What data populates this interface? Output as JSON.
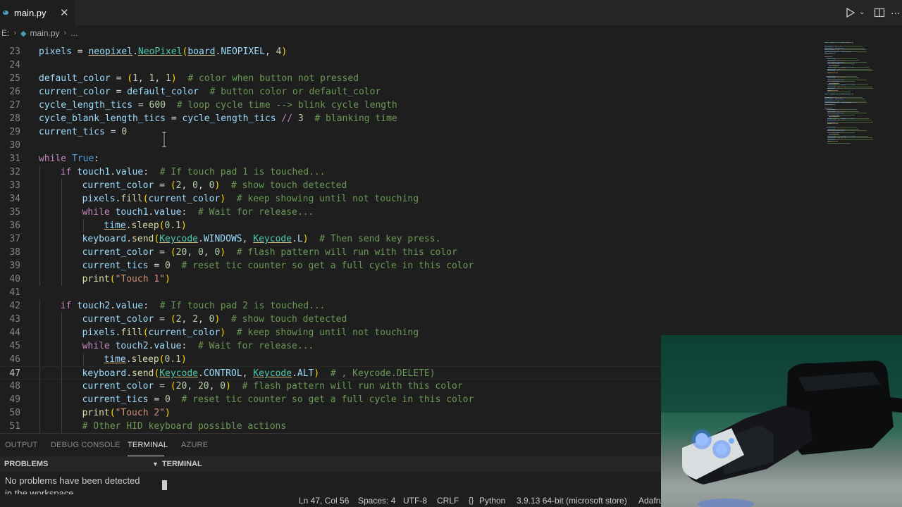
{
  "tab": {
    "filename": "main.py",
    "close": "✕"
  },
  "toolbar": {
    "run": "Run Python File",
    "split": "Split Editor",
    "more": "..."
  },
  "breadcrumb": {
    "drive": "E:",
    "file": "main.py",
    "more": "..."
  },
  "editor": {
    "current_line": 47,
    "lines": [
      {
        "n": "23",
        "indent": 0,
        "tokens": [
          [
            "var",
            "pixels"
          ],
          [
            "op",
            " = "
          ],
          [
            "var u",
            "neopixel"
          ],
          [
            "op",
            "."
          ],
          [
            "cls u",
            "NeoPixel"
          ],
          [
            "br1",
            "("
          ],
          [
            "var u",
            "board"
          ],
          [
            "op",
            "."
          ],
          [
            "var",
            "NEOPIXEL"
          ],
          [
            "op",
            ", "
          ],
          [
            "num",
            "4"
          ],
          [
            "br1",
            ")"
          ]
        ]
      },
      {
        "n": "24",
        "indent": 0,
        "tokens": []
      },
      {
        "n": "25",
        "indent": 0,
        "tokens": [
          [
            "var",
            "default_color"
          ],
          [
            "op",
            " = "
          ],
          [
            "br1",
            "("
          ],
          [
            "num",
            "1"
          ],
          [
            "op",
            ", "
          ],
          [
            "num",
            "1"
          ],
          [
            "op",
            ", "
          ],
          [
            "num",
            "1"
          ],
          [
            "br1",
            ")"
          ],
          [
            "op",
            "  "
          ],
          [
            "cm",
            "# color when button not pressed"
          ]
        ]
      },
      {
        "n": "26",
        "indent": 0,
        "tokens": [
          [
            "var",
            "current_color"
          ],
          [
            "op",
            " = "
          ],
          [
            "var",
            "default_color"
          ],
          [
            "op",
            "  "
          ],
          [
            "cm",
            "# button color or default_color"
          ]
        ]
      },
      {
        "n": "27",
        "indent": 0,
        "tokens": [
          [
            "var",
            "cycle_length_tics"
          ],
          [
            "op",
            " = "
          ],
          [
            "num",
            "600"
          ],
          [
            "op",
            "  "
          ],
          [
            "cm",
            "# loop cycle time --> blink cycle length"
          ]
        ]
      },
      {
        "n": "28",
        "indent": 0,
        "tokens": [
          [
            "var",
            "cycle_blank_length_tics"
          ],
          [
            "op",
            " = "
          ],
          [
            "var",
            "cycle_length_tics"
          ],
          [
            "op",
            " "
          ],
          [
            "kw",
            "//"
          ],
          [
            "op",
            " "
          ],
          [
            "num",
            "3"
          ],
          [
            "op",
            "  "
          ],
          [
            "cm",
            "# blanking time"
          ]
        ]
      },
      {
        "n": "29",
        "indent": 0,
        "tokens": [
          [
            "var",
            "current_tics"
          ],
          [
            "op",
            " = "
          ],
          [
            "num",
            "0"
          ]
        ]
      },
      {
        "n": "30",
        "indent": 0,
        "tokens": []
      },
      {
        "n": "31",
        "indent": 0,
        "tokens": [
          [
            "kw",
            "while"
          ],
          [
            "op",
            " "
          ],
          [
            "const",
            "True"
          ],
          [
            "op",
            ":"
          ]
        ]
      },
      {
        "n": "32",
        "indent": 1,
        "tokens": [
          [
            "kw",
            "if"
          ],
          [
            "op",
            " "
          ],
          [
            "var",
            "touch1"
          ],
          [
            "op",
            "."
          ],
          [
            "var",
            "value"
          ],
          [
            "op",
            ":  "
          ],
          [
            "cm",
            "# If touch pad 1 is touched..."
          ]
        ]
      },
      {
        "n": "33",
        "indent": 2,
        "tokens": [
          [
            "var",
            "current_color"
          ],
          [
            "op",
            " = "
          ],
          [
            "br1",
            "("
          ],
          [
            "num",
            "2"
          ],
          [
            "op",
            ", "
          ],
          [
            "num",
            "0"
          ],
          [
            "op",
            ", "
          ],
          [
            "num",
            "0"
          ],
          [
            "br1",
            ")"
          ],
          [
            "op",
            "  "
          ],
          [
            "cm",
            "# show touch detected"
          ]
        ]
      },
      {
        "n": "34",
        "indent": 2,
        "tokens": [
          [
            "var",
            "pixels"
          ],
          [
            "op",
            "."
          ],
          [
            "fn",
            "fill"
          ],
          [
            "br1",
            "("
          ],
          [
            "var",
            "current_color"
          ],
          [
            "br1",
            ")"
          ],
          [
            "op",
            "  "
          ],
          [
            "cm",
            "# keep showing until not touching"
          ]
        ]
      },
      {
        "n": "35",
        "indent": 2,
        "tokens": [
          [
            "kw",
            "while"
          ],
          [
            "op",
            " "
          ],
          [
            "var",
            "touch1"
          ],
          [
            "op",
            "."
          ],
          [
            "var",
            "value"
          ],
          [
            "op",
            ":  "
          ],
          [
            "cm",
            "# Wait for release..."
          ]
        ]
      },
      {
        "n": "36",
        "indent": 3,
        "tokens": [
          [
            "var u",
            "time"
          ],
          [
            "op",
            "."
          ],
          [
            "fn",
            "sleep"
          ],
          [
            "br1",
            "("
          ],
          [
            "num",
            "0.1"
          ],
          [
            "br1",
            ")"
          ]
        ]
      },
      {
        "n": "37",
        "indent": 2,
        "tokens": [
          [
            "var",
            "keyboard"
          ],
          [
            "op",
            "."
          ],
          [
            "fn",
            "send"
          ],
          [
            "br1",
            "("
          ],
          [
            "cls u",
            "Keycode"
          ],
          [
            "op",
            "."
          ],
          [
            "var",
            "WINDOWS"
          ],
          [
            "op",
            ", "
          ],
          [
            "cls u",
            "Keycode"
          ],
          [
            "op",
            "."
          ],
          [
            "var",
            "L"
          ],
          [
            "br1",
            ")"
          ],
          [
            "op",
            "  "
          ],
          [
            "cm",
            "# Then send key press."
          ]
        ]
      },
      {
        "n": "38",
        "indent": 2,
        "tokens": [
          [
            "var",
            "current_color"
          ],
          [
            "op",
            " = "
          ],
          [
            "br1",
            "("
          ],
          [
            "num",
            "20"
          ],
          [
            "op",
            ", "
          ],
          [
            "num",
            "0"
          ],
          [
            "op",
            ", "
          ],
          [
            "num",
            "0"
          ],
          [
            "br1",
            ")"
          ],
          [
            "op",
            "  "
          ],
          [
            "cm",
            "# flash pattern will run with this color"
          ]
        ]
      },
      {
        "n": "39",
        "indent": 2,
        "tokens": [
          [
            "var",
            "current_tics"
          ],
          [
            "op",
            " = "
          ],
          [
            "num",
            "0"
          ],
          [
            "op",
            "  "
          ],
          [
            "cm",
            "# reset tic counter so get a full cycle in this color"
          ]
        ]
      },
      {
        "n": "40",
        "indent": 2,
        "tokens": [
          [
            "fn",
            "print"
          ],
          [
            "br1",
            "("
          ],
          [
            "str",
            "\"Touch 1\""
          ],
          [
            "br1",
            ")"
          ]
        ]
      },
      {
        "n": "41",
        "indent": 0,
        "tokens": []
      },
      {
        "n": "42",
        "indent": 1,
        "tokens": [
          [
            "kw",
            "if"
          ],
          [
            "op",
            " "
          ],
          [
            "var",
            "touch2"
          ],
          [
            "op",
            "."
          ],
          [
            "var",
            "value"
          ],
          [
            "op",
            ":  "
          ],
          [
            "cm",
            "# If touch pad 2 is touched..."
          ]
        ]
      },
      {
        "n": "43",
        "indent": 2,
        "tokens": [
          [
            "var",
            "current_color"
          ],
          [
            "op",
            " = "
          ],
          [
            "br1",
            "("
          ],
          [
            "num",
            "2"
          ],
          [
            "op",
            ", "
          ],
          [
            "num",
            "2"
          ],
          [
            "op",
            ", "
          ],
          [
            "num",
            "0"
          ],
          [
            "br1",
            ")"
          ],
          [
            "op",
            "  "
          ],
          [
            "cm",
            "# show touch detected"
          ]
        ]
      },
      {
        "n": "44",
        "indent": 2,
        "tokens": [
          [
            "var",
            "pixels"
          ],
          [
            "op",
            "."
          ],
          [
            "fn",
            "fill"
          ],
          [
            "br1",
            "("
          ],
          [
            "var",
            "current_color"
          ],
          [
            "br1",
            ")"
          ],
          [
            "op",
            "  "
          ],
          [
            "cm",
            "# keep showing until not touching"
          ]
        ]
      },
      {
        "n": "45",
        "indent": 2,
        "tokens": [
          [
            "kw",
            "while"
          ],
          [
            "op",
            " "
          ],
          [
            "var",
            "touch2"
          ],
          [
            "op",
            "."
          ],
          [
            "var",
            "value"
          ],
          [
            "op",
            ":  "
          ],
          [
            "cm",
            "# Wait for release..."
          ]
        ]
      },
      {
        "n": "46",
        "indent": 3,
        "tokens": [
          [
            "var u",
            "time"
          ],
          [
            "op",
            "."
          ],
          [
            "fn",
            "sleep"
          ],
          [
            "br1",
            "("
          ],
          [
            "num",
            "0.1"
          ],
          [
            "br1",
            ")"
          ]
        ]
      },
      {
        "n": "47",
        "indent": 2,
        "tokens": [
          [
            "var",
            "keyboard"
          ],
          [
            "op",
            "."
          ],
          [
            "fn",
            "send"
          ],
          [
            "br1",
            "("
          ],
          [
            "cls u",
            "Keycode"
          ],
          [
            "op",
            "."
          ],
          [
            "var",
            "CONTROL"
          ],
          [
            "op",
            ", "
          ],
          [
            "cls u",
            "Keycode"
          ],
          [
            "op",
            "."
          ],
          [
            "var",
            "ALT"
          ],
          [
            "br1",
            ")"
          ],
          [
            "op",
            "  "
          ],
          [
            "cm",
            "# , Keycode.DELETE)"
          ]
        ]
      },
      {
        "n": "48",
        "indent": 2,
        "tokens": [
          [
            "var",
            "current_color"
          ],
          [
            "op",
            " = "
          ],
          [
            "br1",
            "("
          ],
          [
            "num",
            "20"
          ],
          [
            "op",
            ", "
          ],
          [
            "num",
            "20"
          ],
          [
            "op",
            ", "
          ],
          [
            "num",
            "0"
          ],
          [
            "br1",
            ")"
          ],
          [
            "op",
            "  "
          ],
          [
            "cm",
            "# flash pattern will run with this color"
          ]
        ]
      },
      {
        "n": "49",
        "indent": 2,
        "tokens": [
          [
            "var",
            "current_tics"
          ],
          [
            "op",
            " = "
          ],
          [
            "num",
            "0"
          ],
          [
            "op",
            "  "
          ],
          [
            "cm",
            "# reset tic counter so get a full cycle in this color"
          ]
        ]
      },
      {
        "n": "50",
        "indent": 2,
        "tokens": [
          [
            "fn",
            "print"
          ],
          [
            "br1",
            "("
          ],
          [
            "str",
            "\"Touch 2\""
          ],
          [
            "br1",
            ")"
          ]
        ]
      },
      {
        "n": "51",
        "indent": 2,
        "tokens": [
          [
            "cm",
            "# Other HID keyboard possible actions"
          ]
        ]
      }
    ]
  },
  "panel": {
    "tabs": [
      "OUTPUT",
      "DEBUG CONSOLE",
      "TERMINAL",
      "AZURE"
    ],
    "active_tab": "TERMINAL",
    "problems_header": "PROBLEMS",
    "terminal_header": "TERMINAL",
    "problems_message": "No problems have been detected in the workspace."
  },
  "statusbar": {
    "position": "Ln 47, Col 56",
    "spaces": "Spaces: 4",
    "encoding": "UTF-8",
    "eol": "CRLF",
    "language": "Python",
    "interpreter": "3.9.13 64-bit (microsoft store)",
    "extra": "Adafru"
  },
  "colors": {
    "editor_bg": "#1e1e1e",
    "keyword": "#c586c0",
    "variable": "#9cdcfe",
    "function": "#dcdcaa",
    "class": "#4ec9b0",
    "number": "#b5cea8",
    "string": "#ce9178",
    "comment": "#6a9955"
  }
}
